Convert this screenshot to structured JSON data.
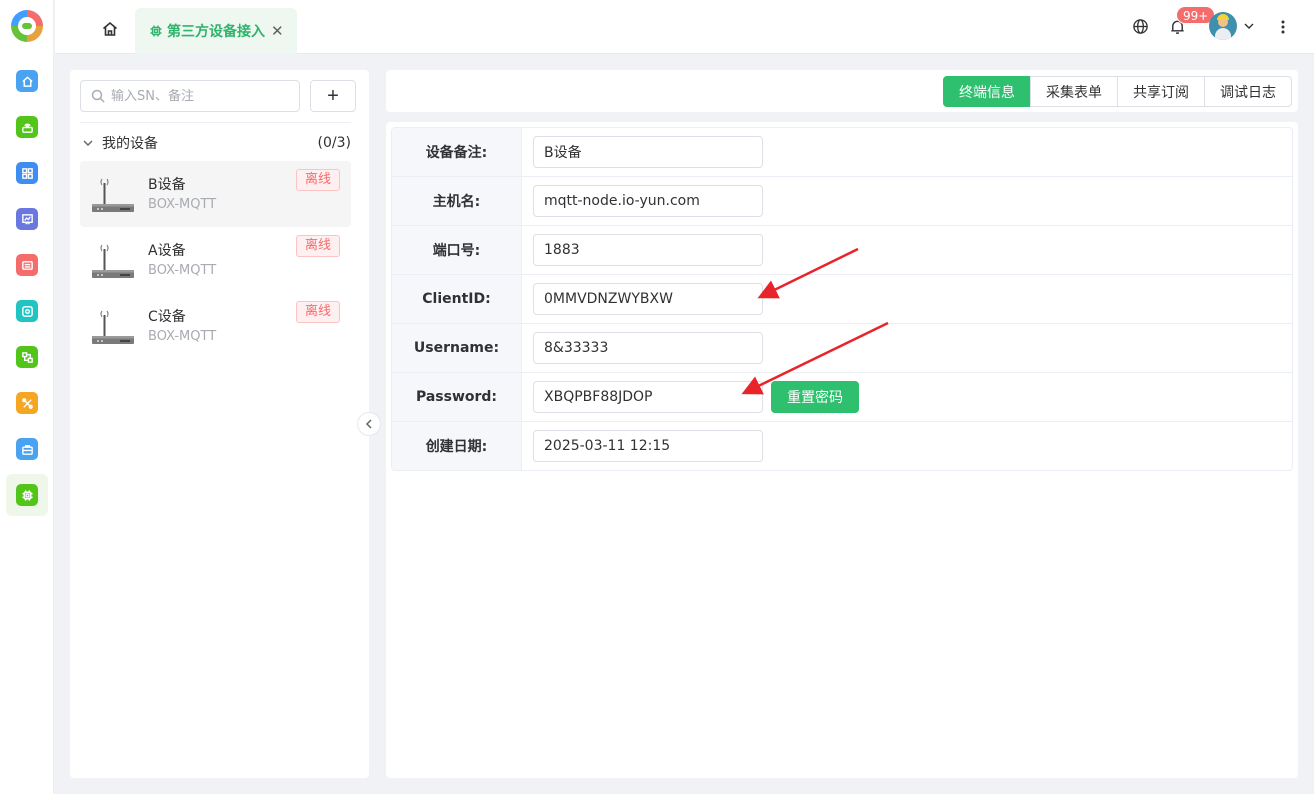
{
  "topbar": {
    "tab_label": "第三方设备接入",
    "notif_badge": "99+",
    "colors": {
      "accent": "#2ebf6f",
      "badge": "#f56c6c"
    }
  },
  "rail": {
    "items": [
      {
        "icon": "home-icon",
        "color": "#4aa3f0"
      },
      {
        "icon": "router-icon",
        "color": "#52c41a"
      },
      {
        "icon": "grid-icon",
        "color": "#3d8ef0"
      },
      {
        "icon": "chart-board-icon",
        "color": "#6b77e0"
      },
      {
        "icon": "keyboard-icon",
        "color": "#f56c6c"
      },
      {
        "icon": "sensor-icon",
        "color": "#22c3c3"
      },
      {
        "icon": "flow-icon",
        "color": "#52c41a"
      },
      {
        "icon": "tools-icon",
        "color": "#f5a623"
      },
      {
        "icon": "briefcase-icon",
        "color": "#4aa3f0"
      },
      {
        "icon": "chip-icon",
        "color": "#52c41a"
      }
    ]
  },
  "left": {
    "search_placeholder": "输入SN、备注",
    "add_label": "+",
    "group_title": "我的设备",
    "group_count": "(0/3)",
    "devices": [
      {
        "name": "B设备",
        "model": "BOX-MQTT",
        "status": "离线",
        "selected": true
      },
      {
        "name": "A设备",
        "model": "BOX-MQTT",
        "status": "离线",
        "selected": false
      },
      {
        "name": "C设备",
        "model": "BOX-MQTT",
        "status": "离线",
        "selected": false
      }
    ]
  },
  "tabs": [
    {
      "label": "终端信息",
      "active": true
    },
    {
      "label": "采集表单",
      "active": false
    },
    {
      "label": "共享订阅",
      "active": false
    },
    {
      "label": "调试日志",
      "active": false
    }
  ],
  "form": {
    "rows": [
      {
        "label": "设备备注:",
        "value": "B设备"
      },
      {
        "label": "主机名:",
        "value": "mqtt-node.io-yun.com"
      },
      {
        "label": "端口号:",
        "value": "1883"
      },
      {
        "label": "ClientID:",
        "value": "0MMVDNZWYBXW"
      },
      {
        "label": "Username:",
        "value": "8&33333"
      },
      {
        "label": "Password:",
        "value": "XBQPBF88JDOP"
      },
      {
        "label": "创建日期:",
        "value": "2025-03-11 12:15"
      }
    ],
    "reset_label": "重置密码"
  }
}
